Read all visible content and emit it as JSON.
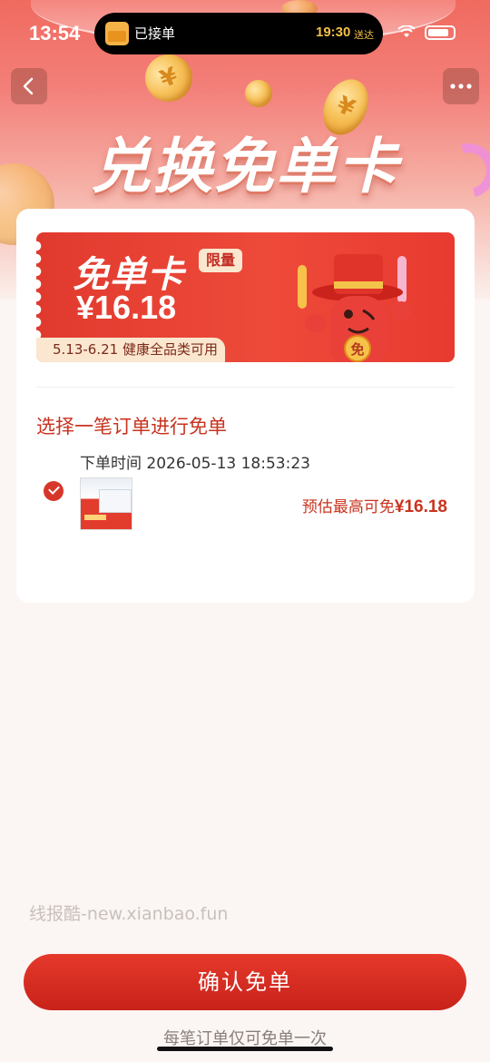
{
  "status_bar": {
    "time": "13:54",
    "island_text": "已接单",
    "island_time": "19:30",
    "island_suffix": "送达"
  },
  "header": {
    "title": "兑换免单卡",
    "back_icon": "chevron-left-icon",
    "more_icon": "more-dots-icon"
  },
  "coupon": {
    "title": "免单卡",
    "tag": "限量",
    "amount": "¥16.18",
    "scope": "5.13-6.21 健康全品类可用",
    "mascot_badge": "免"
  },
  "order_section": {
    "title": "选择一笔订单进行免单",
    "order_time": "下单时间 2026-05-13 18:53:23",
    "estimate_label": "预估最高可免",
    "estimate_amount": "¥16.18",
    "selected": true
  },
  "watermark": "线报酷-new.xianbao.fun",
  "confirm_button": "确认免单",
  "footnote": "每笔订单仅可免单一次",
  "colors": {
    "accent": "#d7372a",
    "text_red": "#c8331f",
    "coupon_bg": "#e03a2e",
    "tag_bg": "#fbe7cf"
  }
}
